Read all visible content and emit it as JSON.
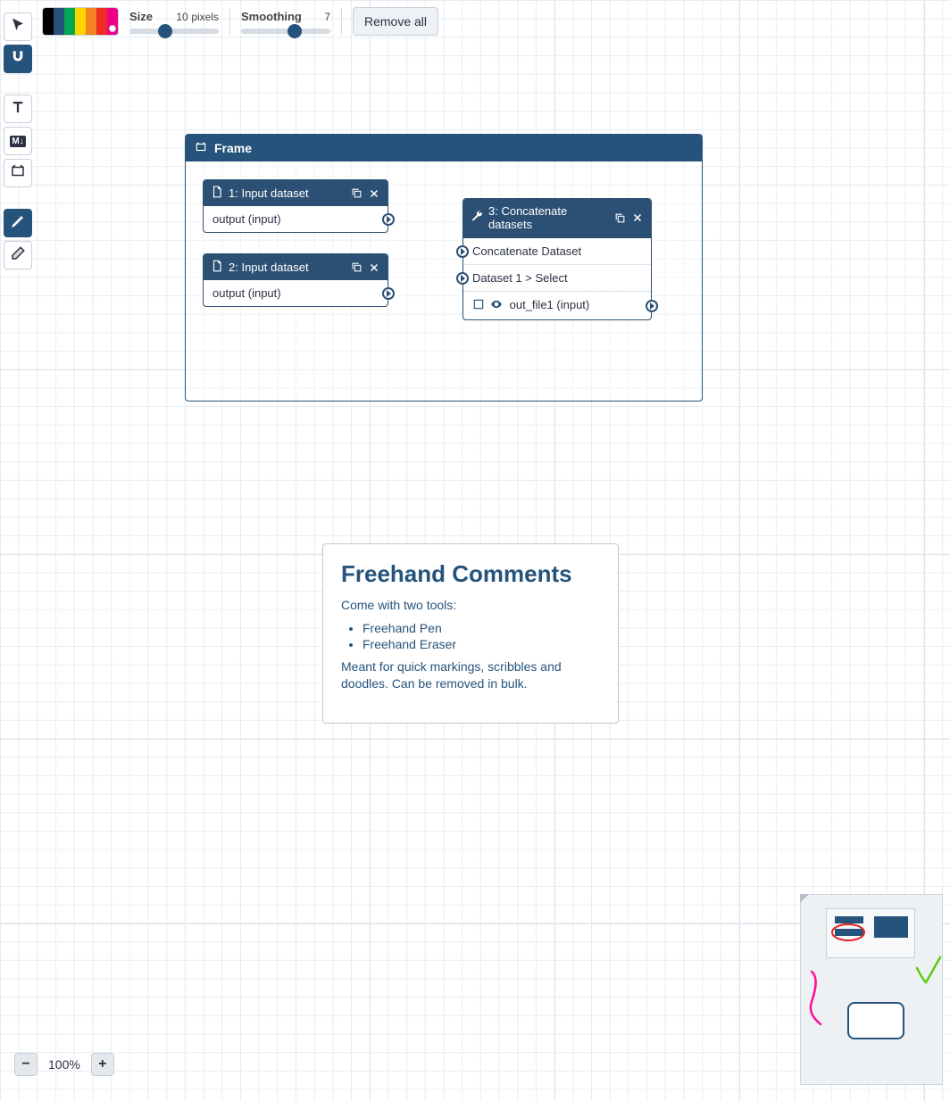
{
  "toolbar": {
    "size_label": "Size",
    "size_value": "10",
    "size_unit": "pixels",
    "smoothing_label": "Smoothing",
    "smoothing_value": "7",
    "remove_all_label": "Remove all"
  },
  "palette": {
    "colors": [
      "#000000",
      "#25537b",
      "#00a651",
      "#ffd400",
      "#f58220",
      "#ee2e24",
      "#ed008c"
    ],
    "selected_index": 6
  },
  "sliders": {
    "size_percent": 40,
    "smoothing_percent": 60
  },
  "frame": {
    "title": "Frame"
  },
  "nodes": {
    "n1": {
      "title": "1: Input dataset",
      "rows": [
        {
          "label": "output (input)",
          "port": "out"
        }
      ]
    },
    "n2": {
      "title": "2: Input dataset",
      "rows": [
        {
          "label": "output (input)",
          "port": "out"
        }
      ]
    },
    "n3": {
      "title": "3: Concatenate datasets",
      "rows": [
        {
          "label": "Concatenate Dataset",
          "port": "in"
        },
        {
          "label": "Dataset 1 > Select",
          "port": "in"
        },
        {
          "label": "out_file1 (input)",
          "port": "out",
          "icons": true
        }
      ]
    }
  },
  "comment": {
    "heading": "Freehand Comments",
    "p1": "Come with two tools:",
    "li1": "Freehand Pen",
    "li2": "Freehand Eraser",
    "p2": "Meant for quick markings, scribbles and doodles. Can be removed in bulk."
  },
  "zoom": {
    "value": "100%"
  },
  "tool_icons": {
    "pointer": "pointer-icon",
    "magnet": "magnet-icon",
    "text": "text-icon",
    "markdown": "markdown-icon",
    "frame": "frame-icon",
    "pen": "pen-icon",
    "eraser": "eraser-icon"
  }
}
